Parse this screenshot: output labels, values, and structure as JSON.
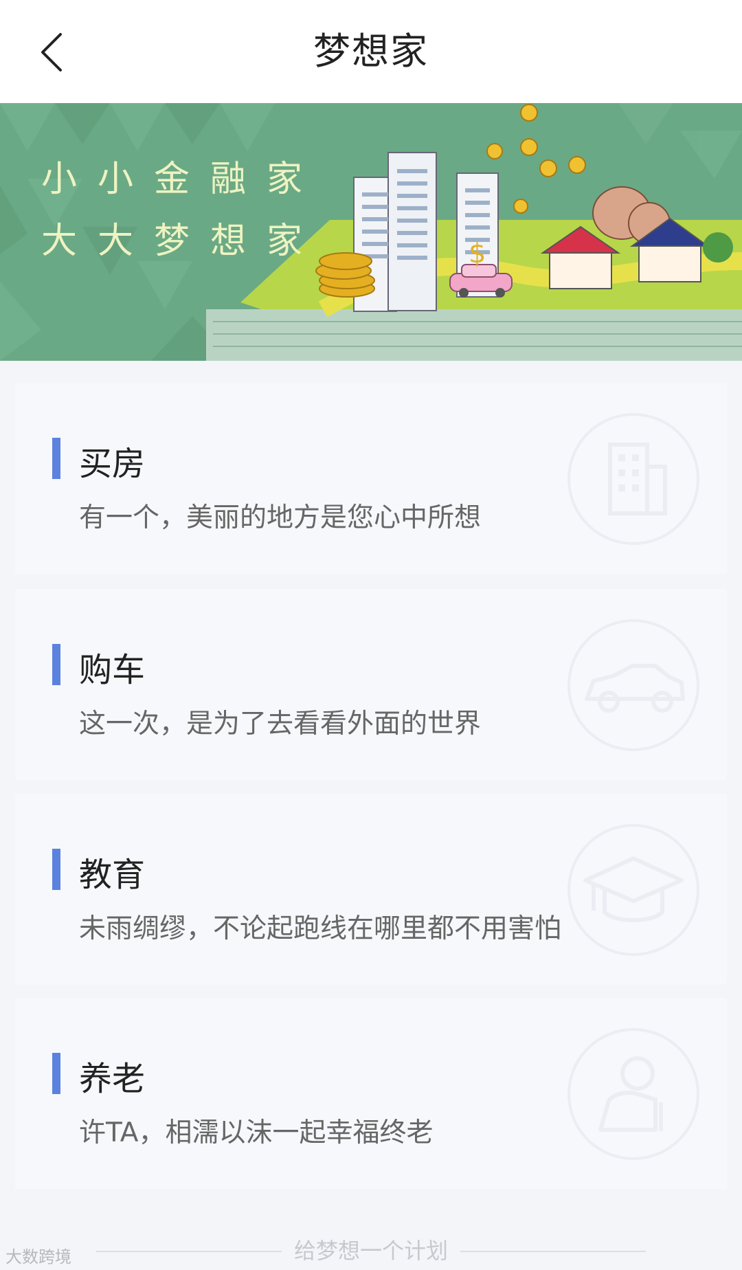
{
  "header": {
    "title": "梦想家",
    "back_icon": "chevron-left-icon"
  },
  "banner": {
    "line1": "小小金融家",
    "line2": "大大梦想家",
    "colors": {
      "background": "#6aa985",
      "grass": "#b7d64a",
      "book": "#b9d3c3"
    }
  },
  "cards": [
    {
      "title": "买房",
      "subtitle": "有一个，美丽的地方是您心中所想",
      "icon": "building-icon"
    },
    {
      "title": "购车",
      "subtitle": "这一次，是为了去看看外面的世界",
      "icon": "car-icon"
    },
    {
      "title": "教育",
      "subtitle": "未雨绸缪，不论起跑线在哪里都不用害怕",
      "icon": "graduation-cap-icon"
    },
    {
      "title": "养老",
      "subtitle": "许TA，相濡以沫一起幸福终老",
      "icon": "elder-person-icon"
    }
  ],
  "footer": {
    "text": "给梦想一个计划",
    "watermark": "大数跨境"
  },
  "colors": {
    "accent": "#5b82de",
    "card_bg": "#f7f8fc",
    "page_bg": "#f4f5f8"
  }
}
